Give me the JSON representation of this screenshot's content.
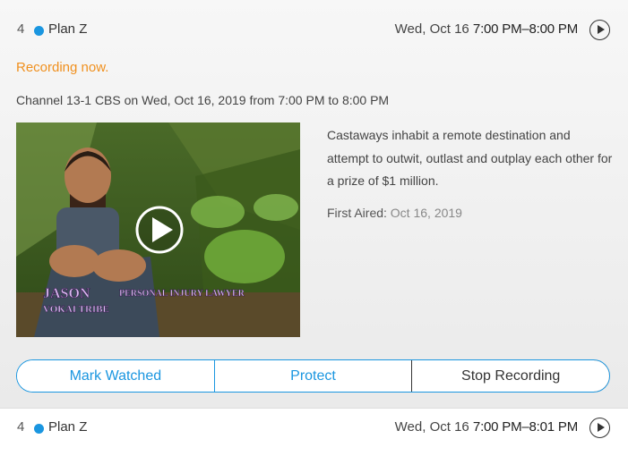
{
  "first_item": {
    "number": "4",
    "title": "Plan Z",
    "date": "Wed, Oct 16",
    "time_range": "7:00 PM–8:00 PM",
    "status": "Recording now.",
    "channel_info": "Channel 13-1 CBS on Wed, Oct 16, 2019 from 7:00 PM to 8:00 PM",
    "description": "Castaways inhabit a remote destination and attempt to outwit, outlast and outplay each other for a prize of $1 million.",
    "first_aired_label": "First Aired:",
    "first_aired_value": "Oct 16, 2019",
    "thumbnail_caption_name": "JASON",
    "thumbnail_caption_role": "PERSONAL INJURY LAWYER",
    "thumbnail_caption_tribe": "VOKAI TRIBE",
    "buttons": {
      "mark_watched": "Mark Watched",
      "protect": "Protect",
      "stop_recording": "Stop Recording"
    }
  },
  "second_item": {
    "number": "4",
    "title": "Plan Z",
    "date": "Wed, Oct 16",
    "time_range": "7:00 PM–8:01 PM"
  },
  "colors": {
    "accent": "#1a96e0",
    "recording": "#f0901e"
  },
  "icons": {
    "status_dot": "dot-icon",
    "play": "play-icon"
  }
}
